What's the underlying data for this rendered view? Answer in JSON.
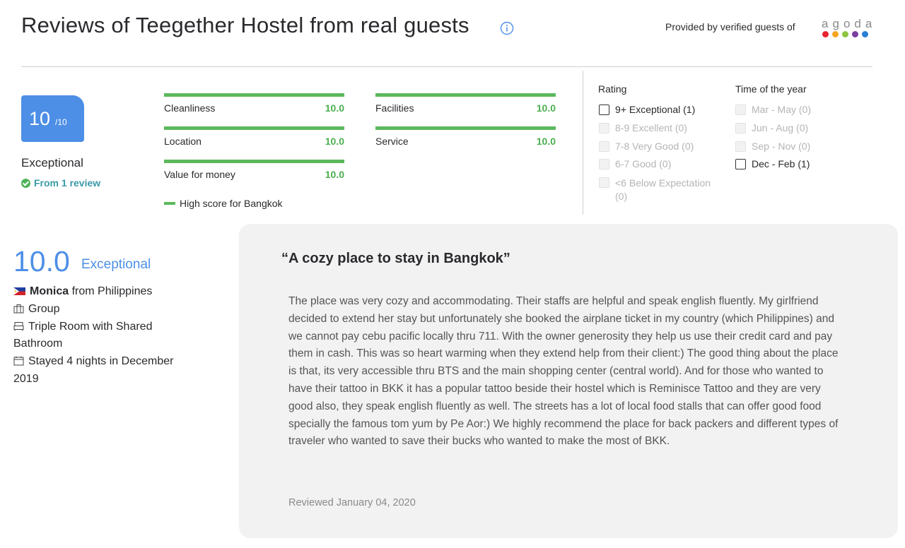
{
  "header": {
    "title": "Reviews of Teegether Hostel from real guests",
    "provided_by": "Provided by verified guests of",
    "brand_letters": [
      "a",
      "g",
      "o",
      "d",
      "a"
    ],
    "brand_dot_colors": [
      "#e8242f",
      "#f6a623",
      "#8dc63f",
      "#7b3fa0",
      "#2a7fd4"
    ]
  },
  "summary": {
    "score": "10",
    "score_max": "/10",
    "score_text": "Exceptional",
    "review_count": "From 1 review"
  },
  "subscores": [
    {
      "label": "Cleanliness",
      "value": "10.0",
      "fill": 1.0
    },
    {
      "label": "Facilities",
      "value": "10.0",
      "fill": 1.0
    },
    {
      "label": "Location",
      "value": "10.0",
      "fill": 1.0
    },
    {
      "label": "Service",
      "value": "10.0",
      "fill": 1.0
    },
    {
      "label": "Value for money",
      "value": "10.0",
      "fill": 1.0
    }
  ],
  "legend": "High score for Bangkok",
  "filters": {
    "rating_title": "Rating",
    "rating": [
      {
        "label": "9+ Exceptional (1)",
        "enabled": true
      },
      {
        "label": "8-9 Excellent (0)",
        "enabled": false
      },
      {
        "label": "7-8 Very Good (0)",
        "enabled": false
      },
      {
        "label": "6-7 Good (0)",
        "enabled": false
      },
      {
        "label": "<6 Below Expectation (0)",
        "enabled": false
      }
    ],
    "time_title": "Time of the year",
    "time": [
      {
        "label": "Mar - May (0)",
        "enabled": false
      },
      {
        "label": "Jun - Aug (0)",
        "enabled": false
      },
      {
        "label": "Sep - Nov (0)",
        "enabled": false
      },
      {
        "label": "Dec - Feb (1)",
        "enabled": true
      }
    ]
  },
  "review": {
    "score": "10.0",
    "score_label": "Exceptional",
    "reviewer_name": "Monica",
    "reviewer_origin": "from Philippines",
    "traveler_type": "Group",
    "room_type": "Triple Room with Shared Bathroom",
    "stay": "Stayed 4 nights in December 2019",
    "title": "“A cozy place to stay in Bangkok”",
    "body": "The place was very cozy and accommodating. Their staffs are helpful and speak english fluently. My girlfriend decided to extend her stay but unfortunately she booked the airplane ticket in my country (which Philippines) and we cannot pay cebu pacific locally thru 711. With the owner generosity they help us use their credit card and pay them in cash. This was so heart warming when they extend help from their client:) The good thing about the place is that, its very accessible thru BTS and the main shopping center (central world). And for those who wanted to have their tattoo in BKK it has a popular tattoo beside their hostel which is Reminisce Tattoo and they are very good also, they speak english fluently as well. The streets has a lot of local food stalls that can offer good food specially the famous tom yum by Pe Aor:) We highly recommend the place for back packers and different types of traveler who wanted to save their bucks who wanted to make the most of BKK.",
    "reviewed_date": "Reviewed January 04, 2020"
  }
}
